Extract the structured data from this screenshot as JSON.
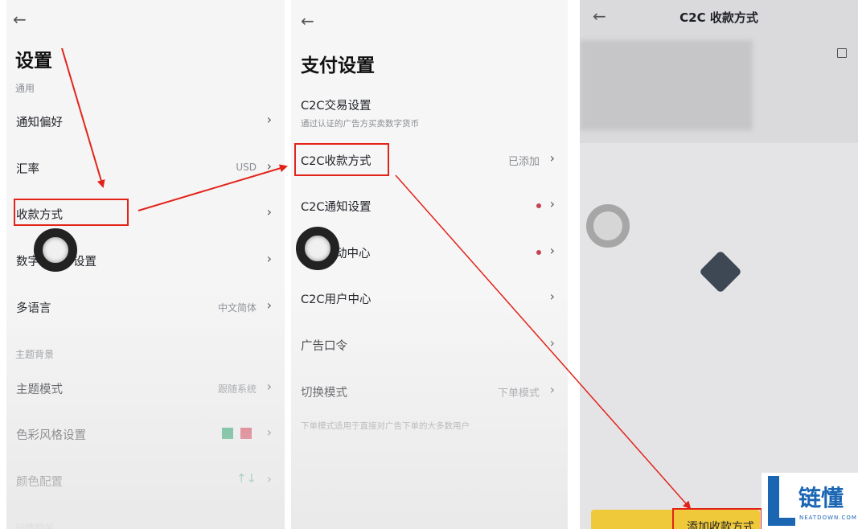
{
  "panel1": {
    "title": "设置",
    "section_general": "通用",
    "rows": [
      {
        "label": "通知偏好",
        "value": ""
      },
      {
        "label": "汇率",
        "value": "USD"
      },
      {
        "label": "收款方式",
        "value": ""
      },
      {
        "label_prefix": "数字",
        "label_suffix": "设置",
        "value": ""
      },
      {
        "label": "多语言",
        "value": "中文简体"
      }
    ],
    "section_theme": "主题背景",
    "theme_rows": [
      {
        "label": "主题模式",
        "value": "跟随系统"
      },
      {
        "label": "色彩风格设置",
        "value": ""
      },
      {
        "label": "颜色配置",
        "value": "↑↓"
      }
    ],
    "section_market": "行情相关",
    "colors": {
      "green": "#1a9e62",
      "red": "#d6374b"
    }
  },
  "panel2": {
    "title": "支付设置",
    "c2c_trade": {
      "label": "C2C交易设置",
      "desc": "通过认证的广告方买卖数字货币"
    },
    "rows": [
      {
        "label": "C2C收款方式",
        "value": "已添加"
      },
      {
        "label": "C2C通知设置",
        "value": ""
      },
      {
        "label": "动中心",
        "value": ""
      },
      {
        "label": "C2C用户中心",
        "value": ""
      },
      {
        "label": "广告口令",
        "value": ""
      },
      {
        "label": "切换模式",
        "value": "下单模式"
      }
    ],
    "mode_note": "下单模式适用于直接对广告下单的大多数用户"
  },
  "panel3": {
    "title": "C2C 收款方式",
    "add_button": "添加收款方式"
  },
  "logo": {
    "text": "链懂",
    "sub": "NEATDOWN.COM"
  },
  "colors": {
    "annotation_red": "#e2231a",
    "yellow": "#f0c93a"
  }
}
